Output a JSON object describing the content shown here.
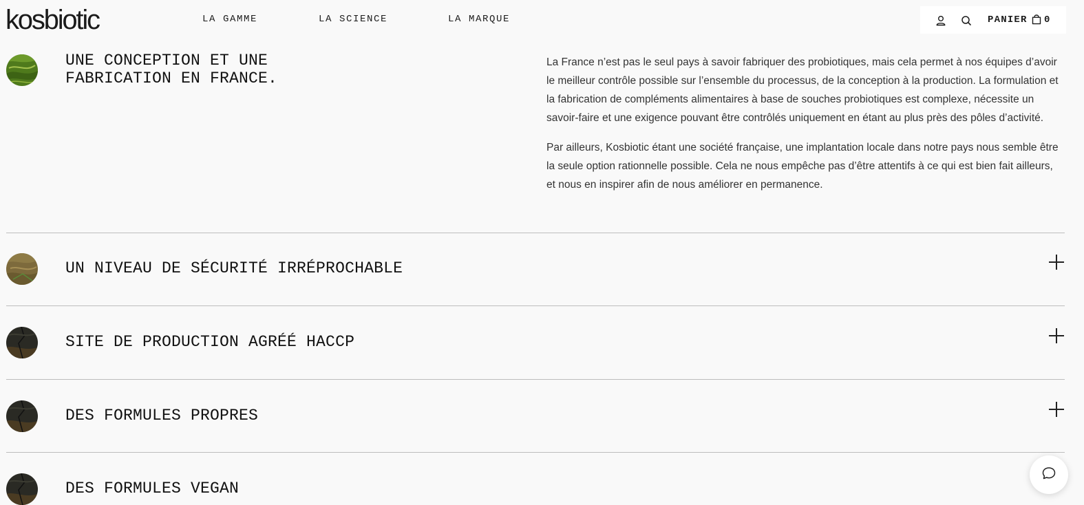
{
  "header": {
    "logo": "kosbiotic",
    "nav": [
      "LA GAMME",
      "LA SCIENCE",
      "LA MARQUE"
    ],
    "account_icon": "user-icon",
    "search_icon": "search-icon",
    "cart_label": "PANIER",
    "cart_icon": "bag-icon",
    "cart_count": "0"
  },
  "accordion": {
    "items": [
      {
        "title_lines": [
          "UNE CONCEPTION ET UNE",
          "FABRICATION EN FRANCE."
        ],
        "expanded": true,
        "thumb_icon": "green-field-thumbnail",
        "paragraphs": [
          "La France n’est pas le seul pays à savoir fabriquer des probiotiques, mais cela permet à nos équipes d’avoir le meilleur contrôle possible sur l’ensemble du processus, de la conception à la production. La formulation et la fabrication de compléments alimentaires à base de souches probiotiques est complexe, nécessite un savoir-faire et une exigence pouvant être contrôlés uniquement en étant au plus près des pôles d’activité.",
          "Par ailleurs, Kosbiotic étant une société française, une implantation locale dans notre pays nous semble être la seule option rationnelle possible. Cela ne nous empêche pas d’être attentifs à ce qui est bien fait ailleurs, et nous en inspirer afin de nous améliorer en permanence."
        ]
      },
      {
        "title": "UN NIVEAU DE SÉCURITÉ IRRÉPROCHABLE",
        "expanded": false,
        "thumb_icon": "earth-terrain-thumbnail",
        "toggle_icon": "plus-icon"
      },
      {
        "title": "SITE DE PRODUCTION AGRÉÉ HACCP",
        "expanded": false,
        "thumb_icon": "dark-terrain-thumbnail",
        "toggle_icon": "plus-icon"
      },
      {
        "title": "DES FORMULES PROPRES",
        "expanded": false,
        "thumb_icon": "dark-terrain-thumbnail",
        "toggle_icon": "plus-icon"
      },
      {
        "title": "DES FORMULES VEGAN",
        "expanded": false,
        "thumb_icon": "dark-terrain-thumbnail",
        "toggle_icon": "plus-icon"
      }
    ]
  },
  "chat": {
    "icon": "chat-bubble-icon"
  },
  "colors": {
    "background": "#f9f9f9",
    "text": "#111111",
    "body_text": "#333333",
    "divider": "#bdbdbd",
    "header_box": "#ffffff"
  }
}
